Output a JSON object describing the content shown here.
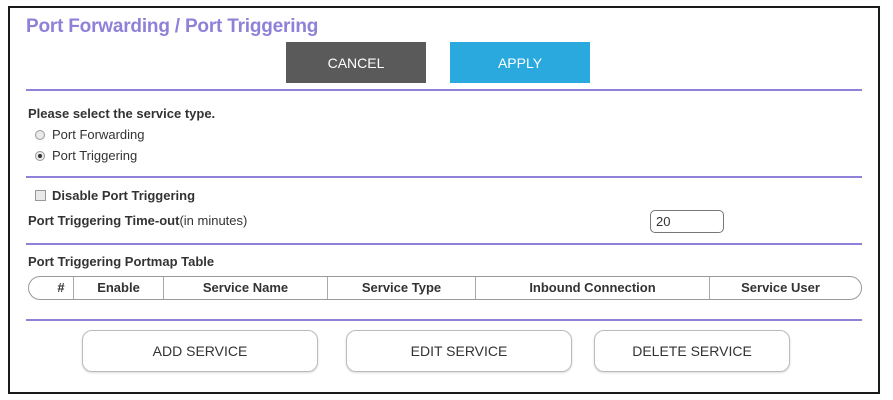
{
  "header": {
    "title": "Port Forwarding / Port Triggering"
  },
  "actions": {
    "cancel_label": "CANCEL",
    "apply_label": "APPLY"
  },
  "service_type": {
    "prompt": "Please select the service type.",
    "options": [
      {
        "label": "Port Forwarding",
        "selected": false
      },
      {
        "label": "Port Triggering",
        "selected": true
      }
    ]
  },
  "triggering": {
    "disable_label": "Disable Port Triggering",
    "disable_checked": false,
    "timeout_label": "Port Triggering Time-out",
    "timeout_unit": "(in minutes)",
    "timeout_value": "20"
  },
  "portmap_table": {
    "title": "Port Triggering Portmap Table",
    "columns": [
      "#",
      "Enable",
      "Service Name",
      "Service Type",
      "Inbound Connection",
      "Service User"
    ]
  },
  "service_actions": {
    "add_label": "ADD SERVICE",
    "edit_label": "EDIT SERVICE",
    "delete_label": "DELETE SERVICE"
  },
  "colors": {
    "title": "#8e81d8",
    "divider": "#8e81d8",
    "cancel": "#5a5a5a",
    "apply": "#2aa9df"
  }
}
